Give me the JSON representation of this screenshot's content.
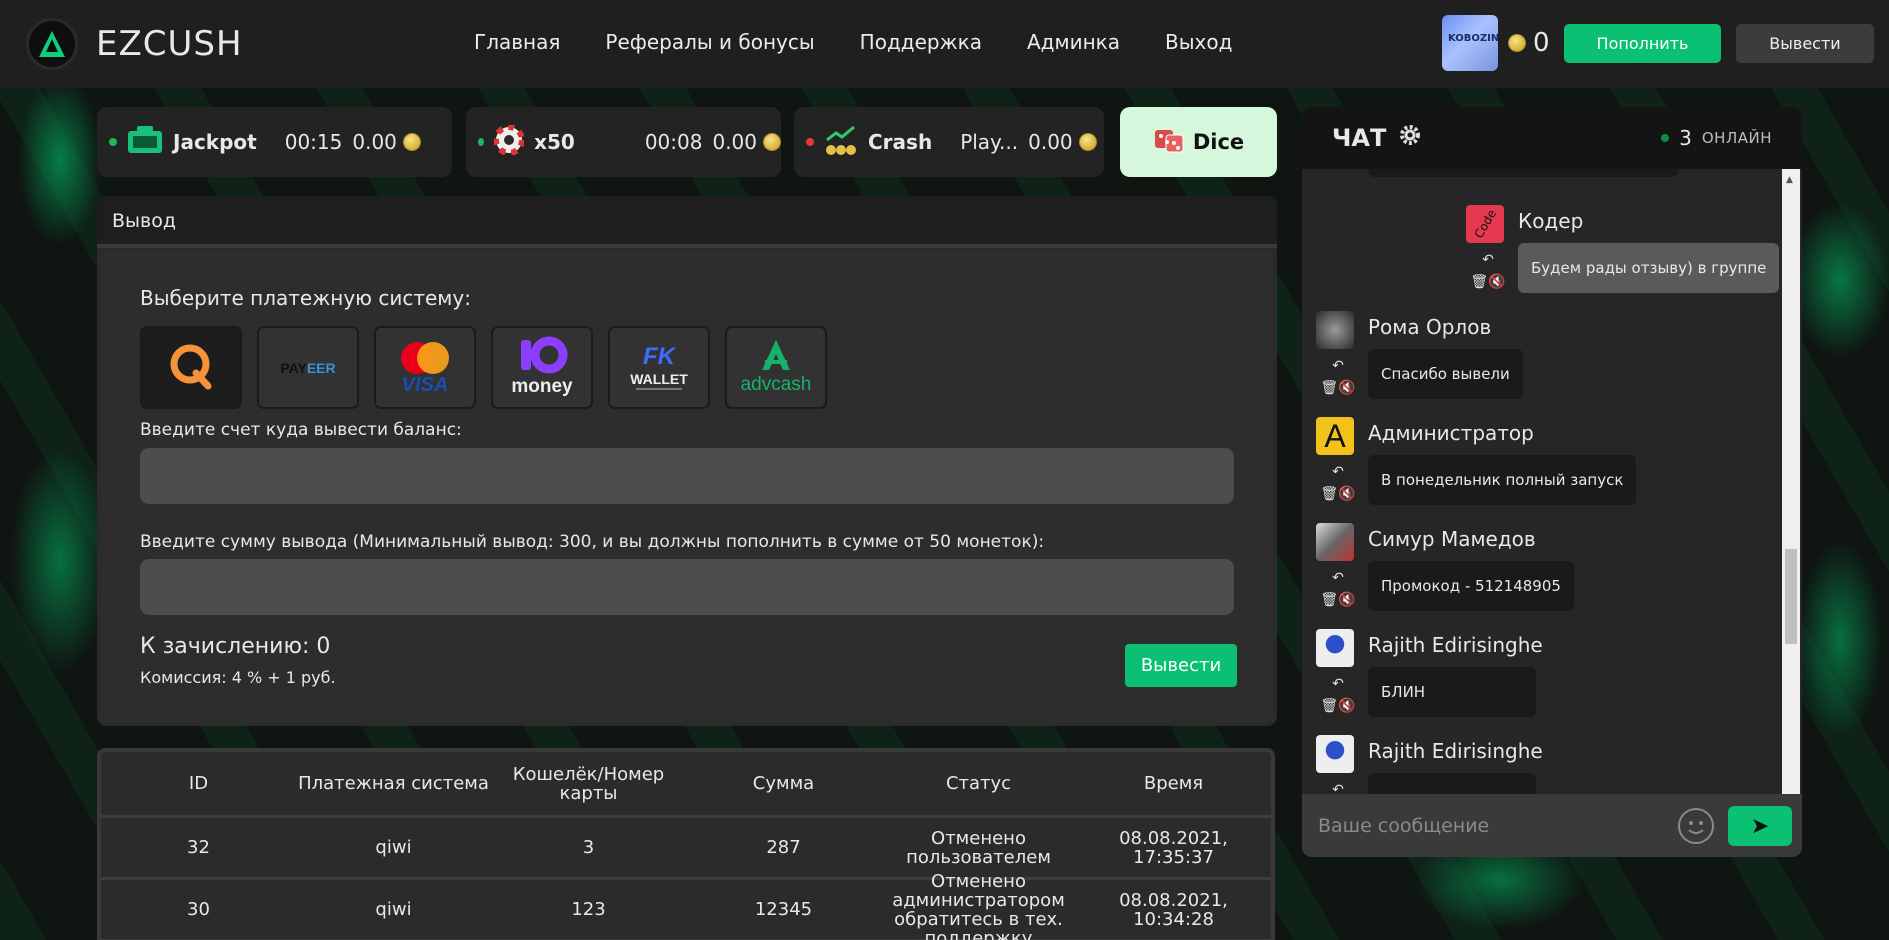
{
  "header": {
    "brand": "EZCUSH",
    "nav": [
      "Главная",
      "Рефералы и бонусы",
      "Поддержка",
      "Админка",
      "Выход"
    ],
    "avatar_text": "KOBOZINE",
    "balance": "0",
    "deposit_label": "Пополнить",
    "withdraw_label": "Вывести"
  },
  "games": [
    {
      "name": "Jackpot",
      "time": "00:15",
      "amount": "0.00",
      "status_color": "#1db954"
    },
    {
      "name": "x50",
      "time": "00:08",
      "amount": "0.00",
      "status_color": "#1db954"
    },
    {
      "name": "Crash",
      "time": "Play...",
      "amount": "0.00",
      "status_color": "#e53935"
    },
    {
      "name": "Dice"
    }
  ],
  "withdraw": {
    "title": "Вывод",
    "choose_label": "Выберите платежную систему:",
    "systems": [
      "qiwi",
      "payeer",
      "mastercard-visa",
      "yoomoney",
      "fk-wallet",
      "advcash"
    ],
    "account_label": "Введите счет куда вывести баланс:",
    "account_value": "",
    "amount_label": "Введите сумму вывода (Минимальный вывод: 300, и вы должны пополнить в сумме от 50 монеток):",
    "amount_value": "",
    "credited_label": "К зачислению: 0",
    "fee_label": "Комиссия: 4 % + 1 руб.",
    "button": "Вывести"
  },
  "table": {
    "headers": [
      "ID",
      "Платежная система",
      "Кошелёк/Номер карты",
      "Сумма",
      "Статус",
      "Время"
    ],
    "rows": [
      [
        "32",
        "qiwi",
        "3",
        "287",
        "Отменено пользователем",
        "08.08.2021, 17:35:37"
      ],
      [
        "30",
        "qiwi",
        "123",
        "12345",
        "Отменено администратором обратитесь в тех. поддержку",
        "08.08.2021, 10:34:28"
      ]
    ]
  },
  "chat": {
    "title": "ЧАТ",
    "online_count": "3",
    "online_label": "ОНЛАЙН",
    "messages": [
      {
        "user": "Кодер",
        "text": "Будем рады отзыву) в группе"
      },
      {
        "user": "Рома Орлов",
        "text": "Спасибо вывели"
      },
      {
        "user": "Администратор",
        "text": "В понедельник полный запуск"
      },
      {
        "user": "Симур Мамедов",
        "text": "Промокод - 512148905"
      },
      {
        "user": "Rajith Edirisinghe",
        "text": "БЛИН"
      },
      {
        "user": "Rajith Edirisinghe",
        "text": ""
      }
    ],
    "input_placeholder": "Ваше сообщение",
    "coder_avatar_text": "Code",
    "admin_avatar_text": "A"
  },
  "colors": {
    "accent": "#0bbf73",
    "panel": "#2b2b2b",
    "header": "#1f1f1f"
  }
}
